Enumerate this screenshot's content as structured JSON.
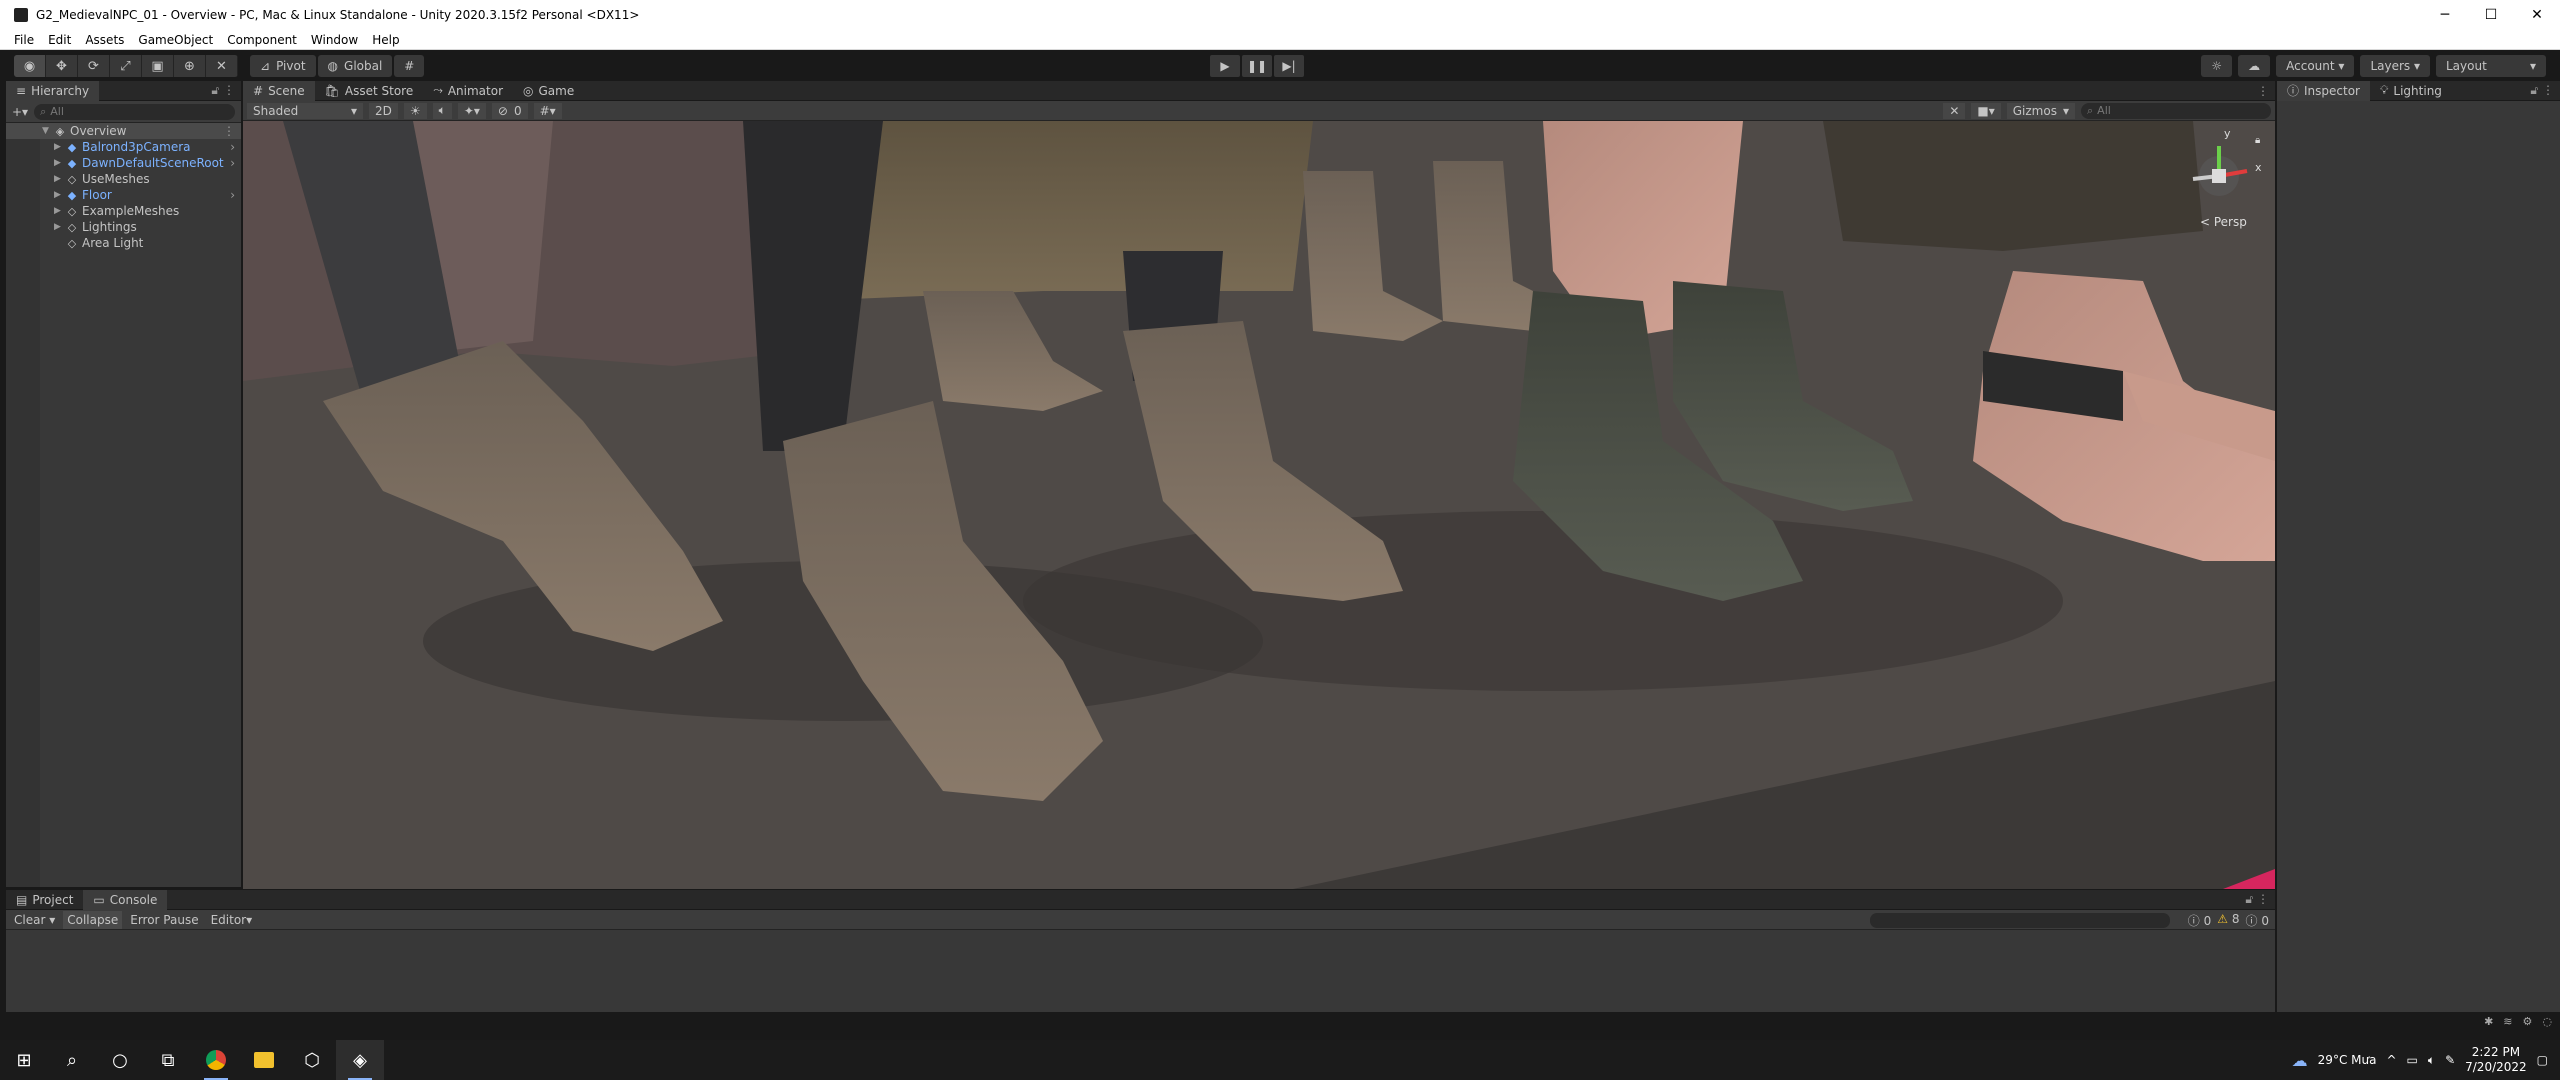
{
  "window": {
    "title": "G2_MedievalNPC_01 - Overview - PC, Mac & Linux Standalone - Unity 2020.3.15f2 Personal <DX11>"
  },
  "menu": [
    "File",
    "Edit",
    "Assets",
    "GameObject",
    "Component",
    "Window",
    "Help"
  ],
  "toolbar": {
    "pivot": "Pivot",
    "global": "Global",
    "account": "Account",
    "layers": "Layers",
    "layout": "Layout"
  },
  "hierarchy": {
    "tab": "Hierarchy",
    "search_placeholder": "All",
    "scene": "Overview",
    "items": [
      {
        "label": "Balrond3pCamera",
        "prefab": true,
        "has_children": true
      },
      {
        "label": "DawnDefaultSceneRoot",
        "prefab": true,
        "has_children": true
      },
      {
        "label": "UseMeshes",
        "prefab": false,
        "has_children": true
      },
      {
        "label": "Floor",
        "prefab": true,
        "has_children": true
      },
      {
        "label": "ExampleMeshes",
        "prefab": false,
        "has_children": true
      },
      {
        "label": "Lightings",
        "prefab": false,
        "has_children": true
      },
      {
        "label": "Area Light",
        "prefab": false,
        "has_children": false
      }
    ]
  },
  "scene_tabs": [
    "Scene",
    "Asset Store",
    "Animator",
    "Game"
  ],
  "scene_toolbar": {
    "shading": "Shaded",
    "mode_2d": "2D",
    "hidden_count": "0",
    "gizmos": "Gizmos",
    "search_placeholder": "All",
    "persp": "< Persp",
    "axis_y": "y",
    "axis_x": "x"
  },
  "inspector_tabs": [
    "Inspector",
    "Lighting"
  ],
  "bottom_tabs": [
    "Project",
    "Console"
  ],
  "console": {
    "clear": "Clear",
    "collapse": "Collapse",
    "error_pause": "Error Pause",
    "editor": "Editor",
    "log_count": "0",
    "warn_count": "8",
    "error_count": "0"
  },
  "taskbar": {
    "weather": "29°C  Mưa",
    "time": "2:22 PM",
    "date": "7/20/2022"
  }
}
